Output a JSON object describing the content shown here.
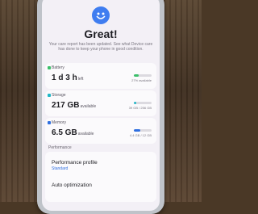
{
  "header": {
    "title": "Great!",
    "subtitle": "Your care report has been updated. See what Device care has done to keep your phone in good condition."
  },
  "cards": {
    "battery": {
      "label": "Battery",
      "value": "1 d 3 h",
      "value_unit": "left",
      "status": "27% available",
      "fill": 0.27,
      "color": "#3bbf6a"
    },
    "storage": {
      "label": "Storage",
      "value": "217 GB",
      "value_unit": "available",
      "status": "39 GB / 256 GB",
      "fill": 0.15,
      "color": "#20b7c7"
    },
    "memory": {
      "label": "Memory",
      "value": "6.5 GB",
      "value_unit": "available",
      "status": "4.4 GB / 12 GB",
      "fill": 0.37,
      "color": "#2f6fe0"
    }
  },
  "performance": {
    "section_label": "Performance",
    "profile_title": "Performance profile",
    "profile_value": "Standard",
    "auto_optimization": "Auto optimization"
  }
}
